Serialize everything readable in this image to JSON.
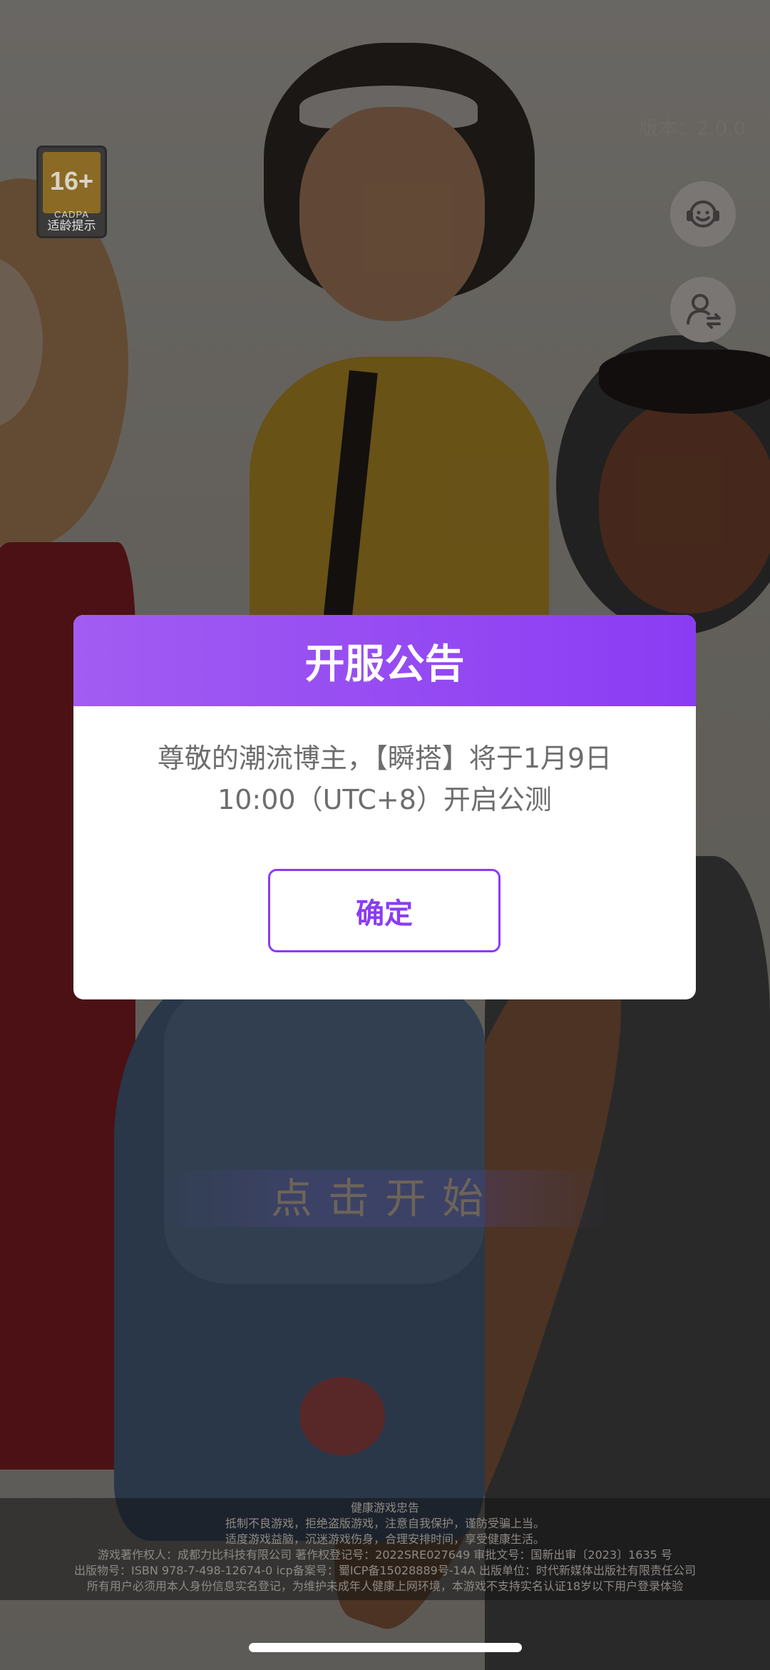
{
  "age_rating": {
    "number": "16+",
    "org": "CADPA",
    "label": "适龄提示"
  },
  "version_label": "版本：2.0.0",
  "side_buttons": [
    {
      "icon": "customer-service-icon"
    },
    {
      "icon": "switch-account-icon"
    }
  ],
  "tap_to_start": "点击开始",
  "dialog": {
    "title": "开服公告",
    "message_line1": "尊敬的潮流博主，【瞬搭】将于1月9日",
    "message_line2": "10:00（UTC+8）开启公测",
    "confirm_label": "确定"
  },
  "footer": {
    "lines": [
      "健康游戏忠告",
      "抵制不良游戏，拒绝盗版游戏，注意自我保护，谨防受骗上当。",
      "适度游戏益脑，沉迷游戏伤身，合理安排时间，享受健康生活。",
      "游戏著作权人：成都力比科技有限公司 著作权登记号：2022SRE027649 审批文号：国新出审〔2023〕1635 号",
      "出版物号：ISBN 978-7-498-12674-0 icp备案号：蜀ICP备15028889号-14A 出版单位：时代新媒体出版社有限责任公司",
      "所有用户必须用本人身份信息实名登记，为维护未成年人健康上网环境，本游戏不支持实名认证18岁以下用户登录体验"
    ]
  },
  "colors": {
    "accent": "#8a3cf3",
    "dialog_header": "#9b52f2"
  }
}
